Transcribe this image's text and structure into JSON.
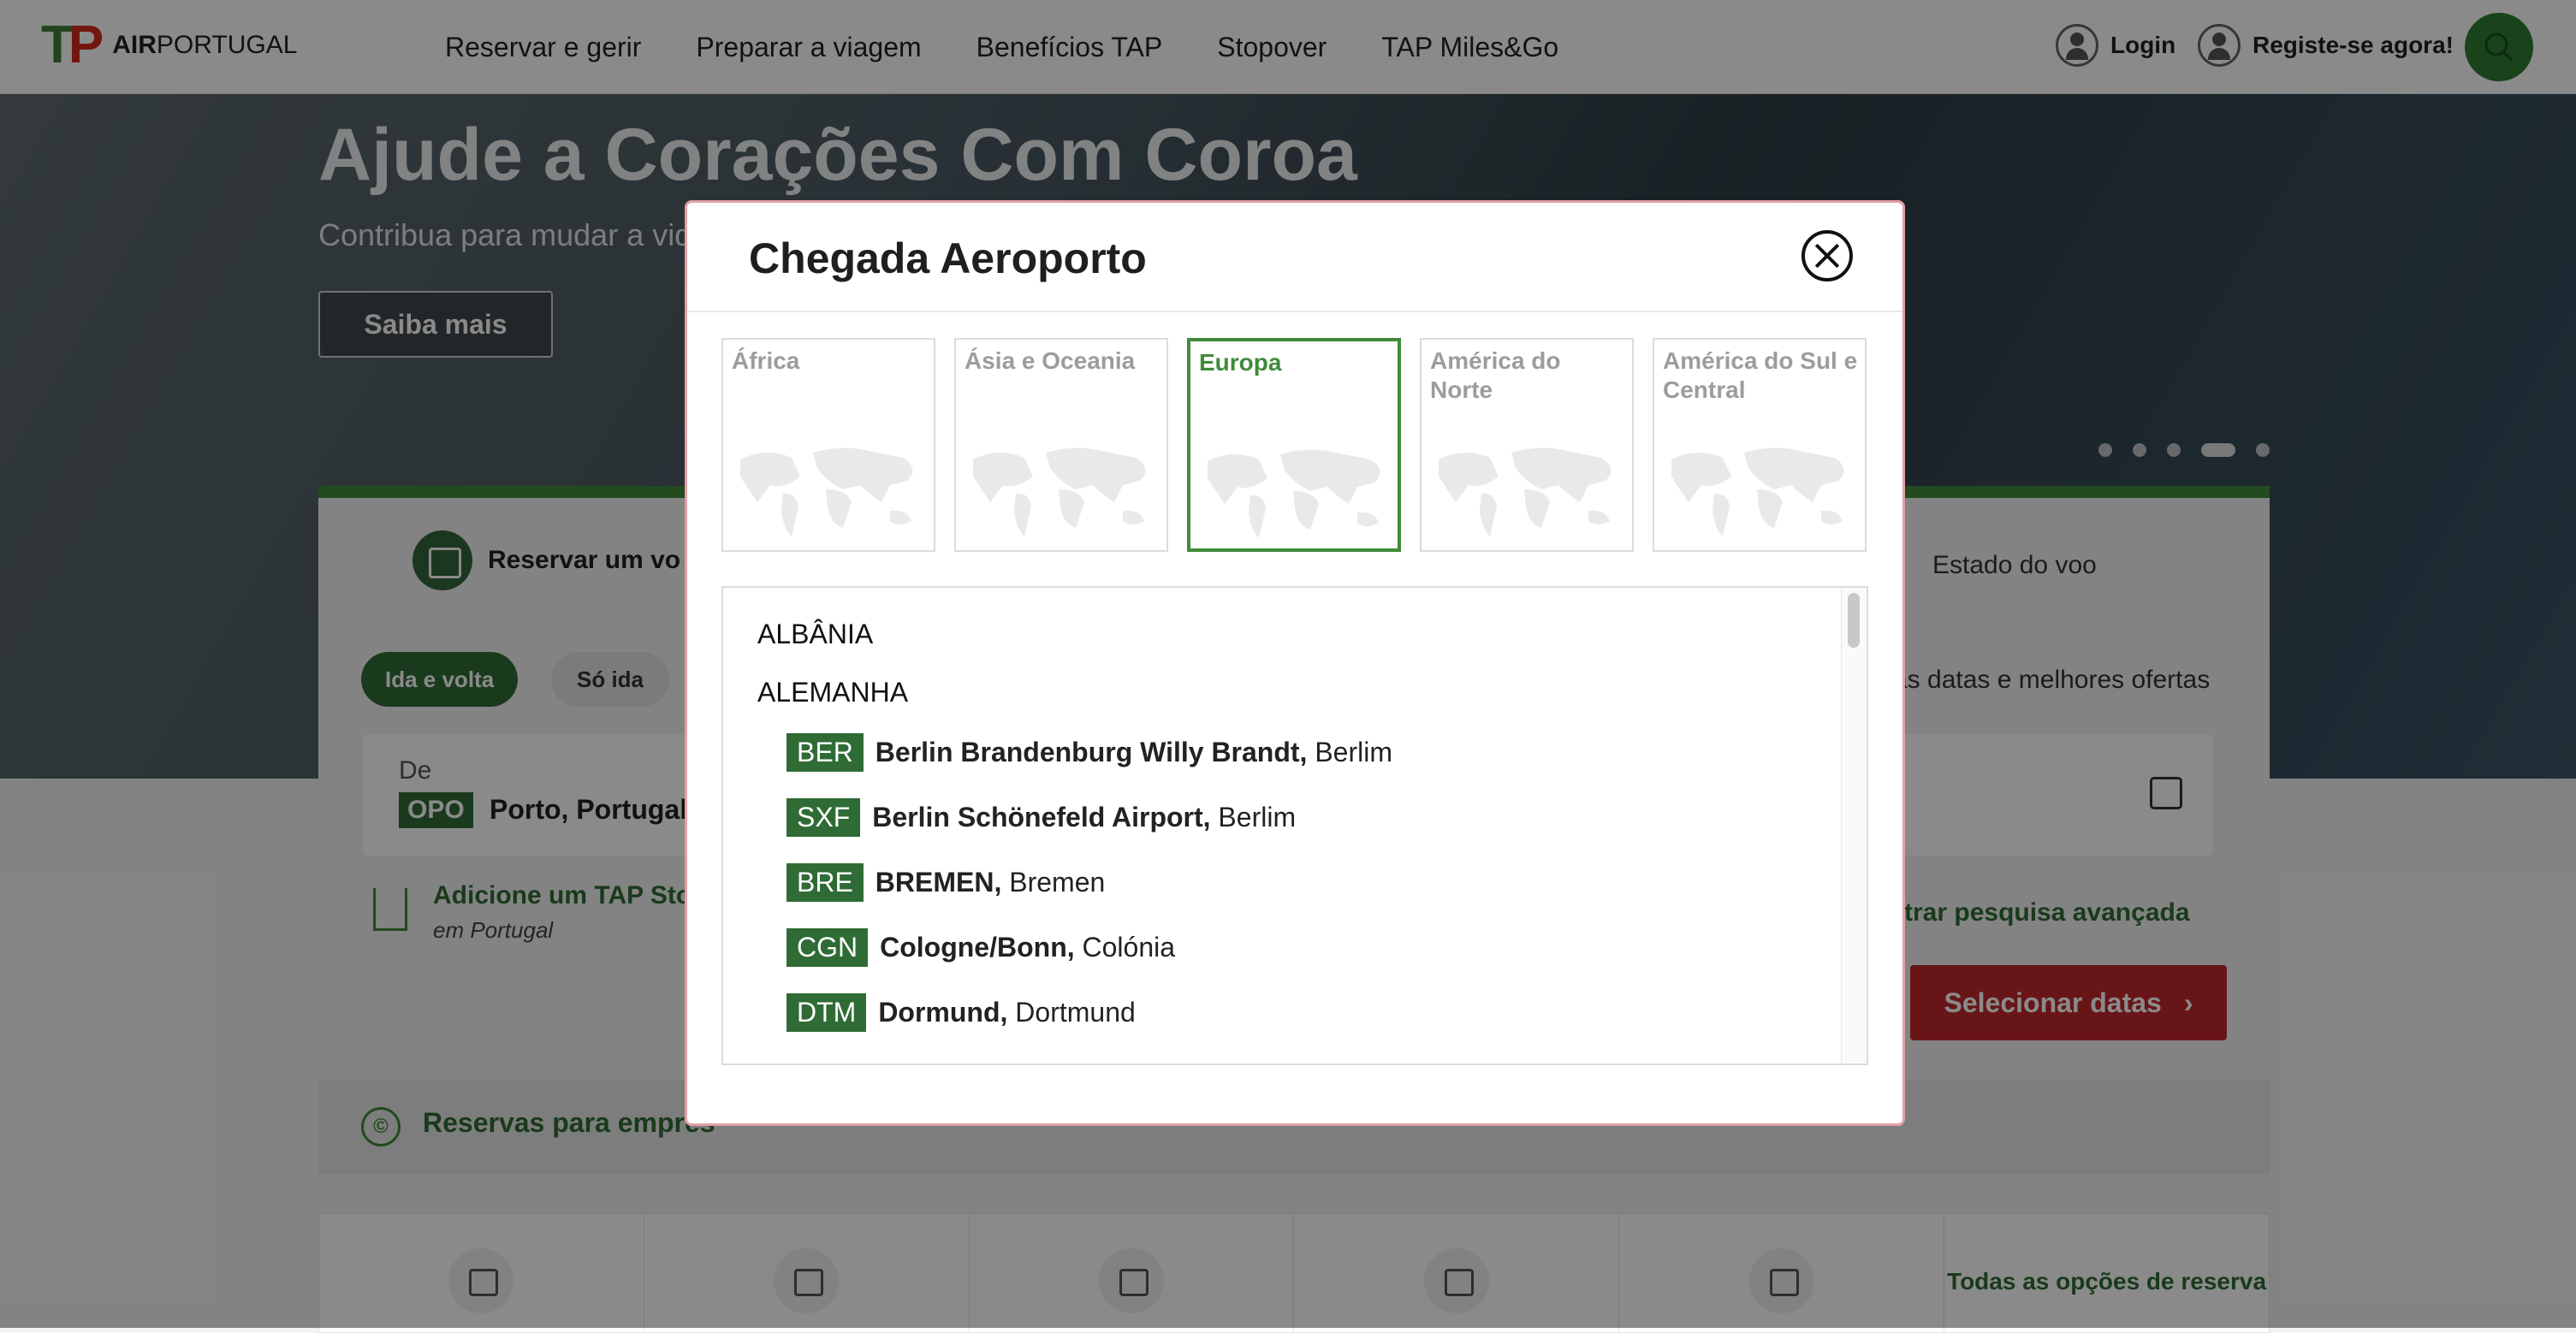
{
  "header": {
    "logo_mark": "TAP",
    "logo_text_bold": "AIR",
    "logo_text": "PORTUGAL",
    "nav": [
      "Reservar e gerir",
      "Preparar a viagem",
      "Benefícios TAP",
      "Stopover",
      "TAP Miles&Go"
    ],
    "login": "Login",
    "register": "Registe-se agora!"
  },
  "hero": {
    "title": "Ajude a Corações Com Coroa",
    "subtitle": "Contribua para mudar a vid",
    "cta": "Saiba mais"
  },
  "booking": {
    "tab_book": "Reservar um vo",
    "tab_status": "Estado do voo",
    "trip_roundtrip": "Ida e volta",
    "trip_oneway": "Só ida",
    "best_offers": "as datas e melhores ofertas",
    "from_label": "De",
    "from_code": "OPO",
    "from_city": "Porto, Portugal",
    "stopover_title": "Adicione um TAP Sto",
    "stopover_sub": "em Portugal",
    "advanced": "ostrar pesquisa avançada",
    "select_dates": "Selecionar datas",
    "corporate": "Reservas para empres"
  },
  "options": {
    "all_label": "Todas as opções de reserva"
  },
  "modal": {
    "title": "Chegada Aeroporto",
    "regions": [
      {
        "label": "África",
        "selected": false
      },
      {
        "label": "Ásia e Oceania",
        "selected": false
      },
      {
        "label": "Europa",
        "selected": true
      },
      {
        "label": "América do Norte",
        "selected": false
      },
      {
        "label": "América do Sul e Central",
        "selected": false
      }
    ],
    "countries": [
      {
        "name": "ALBÂNIA",
        "airports": []
      },
      {
        "name": "ALEMANHA",
        "airports": [
          {
            "code": "BER",
            "name": "Berlin Brandenburg Willy Brandt,",
            "city": "Berlim"
          },
          {
            "code": "SXF",
            "name": "Berlin Schönefeld Airport,",
            "city": "Berlim"
          },
          {
            "code": "BRE",
            "name": "BREMEN,",
            "city": "Bremen"
          },
          {
            "code": "CGN",
            "name": "Cologne/Bonn,",
            "city": "Colónia"
          },
          {
            "code": "DTM",
            "name": "Dormund,",
            "city": "Dortmund"
          }
        ]
      }
    ]
  },
  "colors": {
    "brand_green": "#2f6b35",
    "accent_green": "#3f8b3a",
    "brand_red": "#c0282c"
  }
}
